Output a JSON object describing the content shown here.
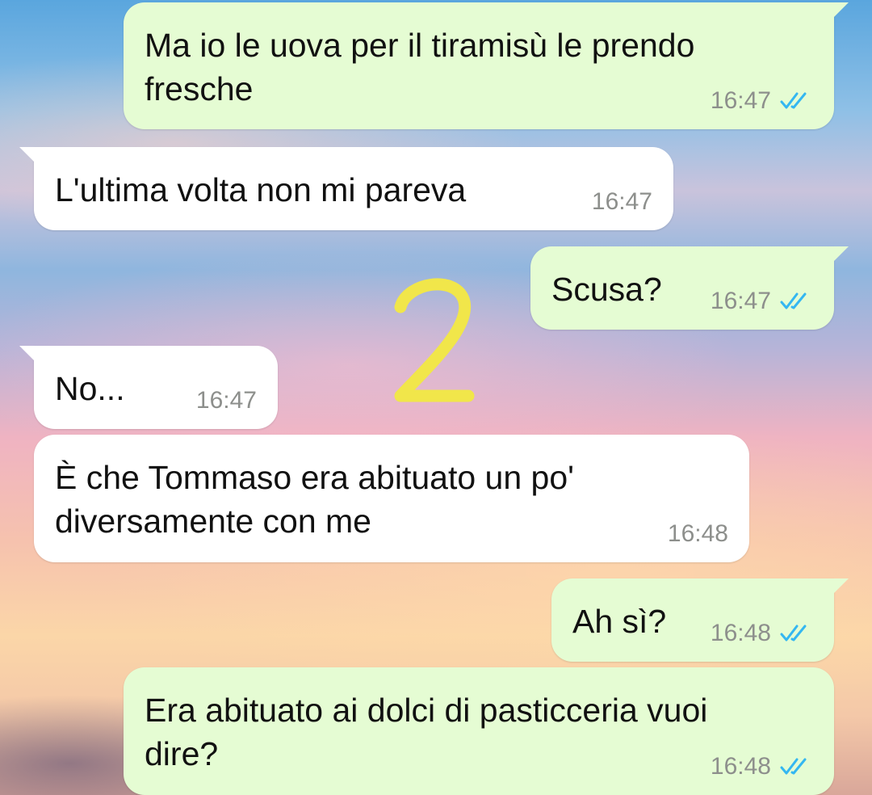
{
  "colors": {
    "outgoing_bubble": "#e5fcd3",
    "incoming_bubble": "#ffffff",
    "read_ticks": "#34b7f1",
    "annotation": "#f1e64a"
  },
  "annotation_label": "2",
  "messages": [
    {
      "direction": "outgoing",
      "text": "Ma io le uova per il tiramisù le prendo\nfresche",
      "time": "16:47",
      "status": "read-ticks-icon"
    },
    {
      "direction": "incoming",
      "text": "L'ultima volta non mi pareva",
      "time": "16:47"
    },
    {
      "direction": "outgoing",
      "text": "Scusa?",
      "time": "16:47",
      "status": "read-ticks-icon"
    },
    {
      "direction": "incoming",
      "text": "No...",
      "time": "16:47"
    },
    {
      "direction": "incoming",
      "text": "È che Tommaso era abituato un po'\ndiversamente con me",
      "time": "16:48"
    },
    {
      "direction": "outgoing",
      "text": "Ah sì?",
      "time": "16:48",
      "status": "read-ticks-icon"
    },
    {
      "direction": "outgoing",
      "text": "Era abituato ai dolci di pasticceria vuoi\ndire?",
      "time": "16:48",
      "status": "read-ticks-icon"
    }
  ]
}
